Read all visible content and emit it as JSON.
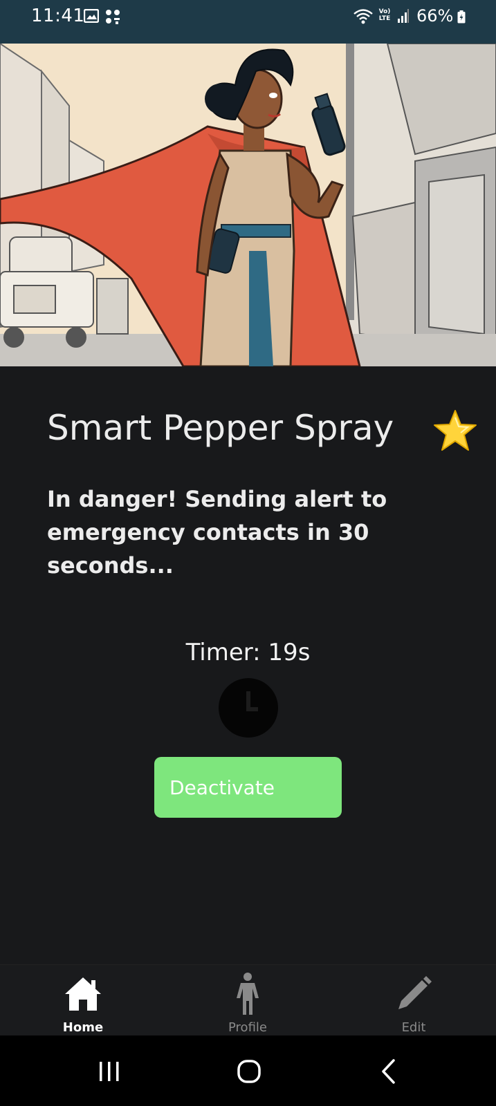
{
  "status_bar": {
    "time": "11:41",
    "network_line1": "Vo)",
    "network_line2": "LTE",
    "battery": "66%"
  },
  "hero": {
    "icon": "superhero-woman-illustration"
  },
  "main": {
    "title": "Smart Pepper Spray",
    "title_icon": "star-icon",
    "alert_message": "In danger! Sending alert to emergency contacts in 30 seconds...",
    "timer_text": "Timer: 19s",
    "timer_icon": "clock-icon",
    "deactivate_label": "Deactivate"
  },
  "bottom_nav": {
    "items": [
      {
        "label": "Home",
        "icon": "home-icon",
        "active": true
      },
      {
        "label": "Profile",
        "icon": "person-icon",
        "active": false
      },
      {
        "label": "Edit",
        "icon": "pencil-icon",
        "active": false
      }
    ]
  },
  "colors": {
    "status_bar": "#1e3a48",
    "background": "#18191b",
    "button": "#7ee67d",
    "nav_active": "#ffffff",
    "nav_inactive": "#8a8a8a"
  }
}
